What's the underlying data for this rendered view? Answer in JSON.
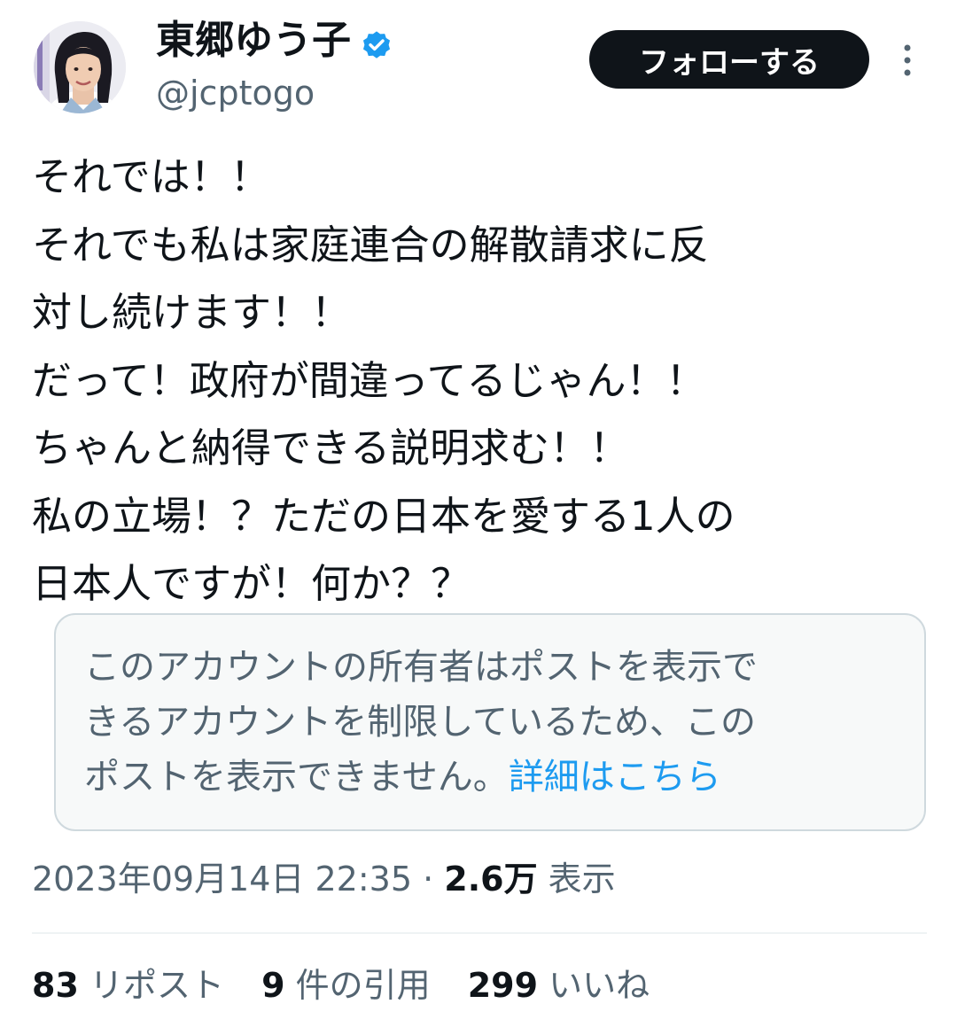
{
  "author": {
    "display_name": "東郷ゆう子",
    "handle": "@jcptogo",
    "avatar_icon": "profile-photo",
    "verified_icon": "verified-badge-icon"
  },
  "header": {
    "follow_label": "フォローする",
    "more_icon": "more-vertical-icon"
  },
  "tweet": {
    "lines": [
      "それでは！！",
      "それでも私は家庭連合の解散請求に反",
      "対し続けます！！",
      "だって！政府が間違ってるじゃん！！",
      "ちゃんと納得できる説明求む！！",
      "私の立場！？ただの日本を愛する1人の",
      "日本人ですが！何か？？"
    ]
  },
  "notice": {
    "lines": [
      "このアカウントの所有者はポストを表示で",
      "きるアカウントを制限しているため、この",
      "ポストを表示できません。"
    ],
    "link": "詳細はこちら"
  },
  "meta": {
    "timestamp": "2023年09月14日 22:35",
    "separator": " · ",
    "views_count": "2.6万",
    "views_label": " 表示"
  },
  "stats": [
    {
      "count": "83",
      "label": " リポスト"
    },
    {
      "count": "9",
      "label": " 件の引用"
    },
    {
      "count": "299",
      "label": " いいね"
    }
  ],
  "colors": {
    "text": "#0f1419",
    "secondary": "#536471",
    "link": "#1d9bf0",
    "button_bg": "#0f1419"
  }
}
